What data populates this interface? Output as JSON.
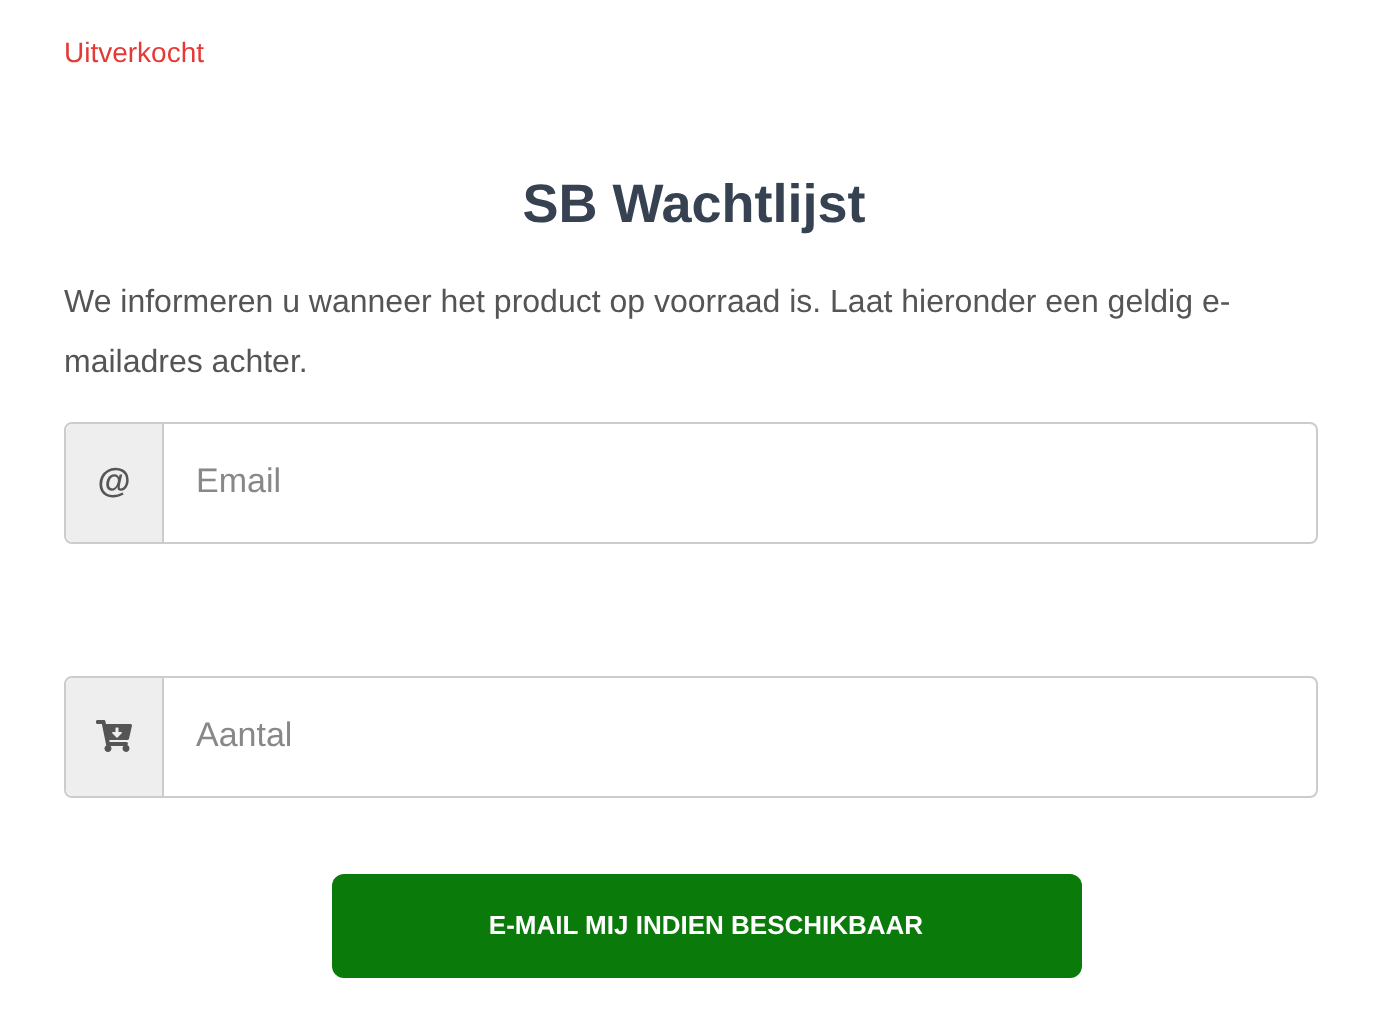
{
  "stock_status": "Uitverkocht",
  "title": "SB Wachtlijst",
  "description": "We informeren u wanneer het product op voorraad is. Laat hieronder een geldig e-mailadres achter.",
  "fields": [
    {
      "kind": "at",
      "addon": "@",
      "placeholder": "Email"
    },
    {
      "kind": "cart",
      "placeholder": "Aantal"
    }
  ],
  "button": "E-MAIL MIJ INDIEN BESCHIKBAAR"
}
